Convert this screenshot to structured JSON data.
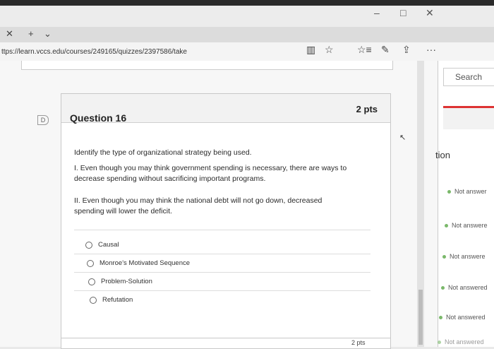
{
  "browser": {
    "url": "ttps://learn.vccs.edu/courses/249165/quizzes/2397586/take",
    "controls": {
      "minimize": "–",
      "maximize": "□",
      "close": "✕"
    },
    "tab_close": "✕",
    "tab_new": "+",
    "tab_menu": "⌄",
    "toolbar": {
      "reading": "▥",
      "favorite": "☆",
      "favorites_list": "☆≡",
      "notes": "✎",
      "share": "⇪",
      "more": "···"
    }
  },
  "question": {
    "title": "Question 16",
    "points": "2 pts",
    "prompt": "Identify the type of organizational strategy being used.",
    "statement1": "I. Even though you may think government spending is necessary, there are ways to decrease spending without sacrificing important programs.",
    "statement2": "II. Even though you may think the national debt will not go down, decreased spending will lower the deficit.",
    "options": [
      "Causal",
      "Monroe's Motivated Sequence",
      "Problem-Solution",
      "Refutation"
    ]
  },
  "next_question": {
    "points": "2 pts"
  },
  "sidebar": {
    "search_label": "Search",
    "heading": "tion",
    "statuses": [
      "Not answer",
      "Not answere",
      "Not answere",
      "Not answered",
      "Not answered",
      "Not answered"
    ]
  }
}
